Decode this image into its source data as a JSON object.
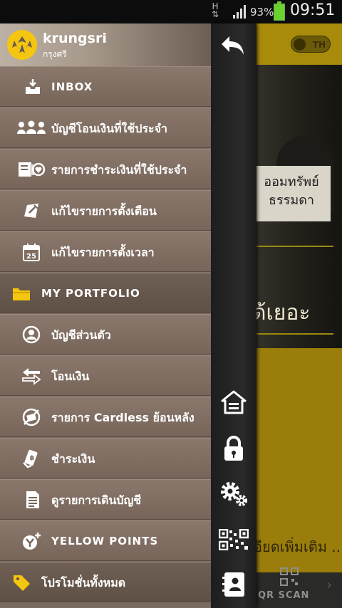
{
  "status_bar": {
    "network": "H",
    "battery_percent": "93%",
    "time": "09:51"
  },
  "header": {
    "brand_name": "krungsri",
    "brand_sub": "กรุงศรี"
  },
  "menu": {
    "items": [
      {
        "label": "INBOX",
        "icon": "inbox-icon"
      },
      {
        "label": "บัญชีโอนเงินที่ใช้ประจำ",
        "icon": "people-group-icon"
      },
      {
        "label": "รายการชำระเงินที่ใช้ประจำ",
        "icon": "bill-heart-icon"
      },
      {
        "label": "แก้ไขรายการตั้งเตือน",
        "icon": "edit-reminder-icon"
      },
      {
        "label": "แก้ไขรายการตั้งเวลา",
        "icon": "calendar-25-icon"
      },
      {
        "label": "MY PORTFOLIO",
        "icon": "folder-icon"
      },
      {
        "label": "บัญชีส่วนตัว",
        "icon": "person-account-icon"
      },
      {
        "label": "โอนเงิน",
        "icon": "transfer-arrows-icon"
      },
      {
        "label": "รายการ Cardless ย้อนหลัง",
        "icon": "cardless-icon"
      },
      {
        "label": "ชำระเงิน",
        "icon": "payment-icon"
      },
      {
        "label": "ดูรายการเดินบัญชี",
        "icon": "statement-icon"
      },
      {
        "label": "YELLOW POINTS",
        "icon": "yellow-points-icon"
      },
      {
        "label": "โปรโมชั่นทั้งหมด",
        "icon": "promotion-tag-icon"
      }
    ]
  },
  "action_bar": {
    "buttons": [
      "back-arrow-icon",
      "home-icon",
      "lock-icon",
      "settings-gears-icon",
      "qr-code-icon",
      "contact-icon"
    ]
  },
  "background_app": {
    "language_toggle": "TH",
    "sign_text": "ออมทรัพย์\nธรรมดา",
    "headline_fragment": "ด้เยอะ",
    "more_link": "อียดเพิ่มเติม ...",
    "bottom_tab_label": "QR SCAN"
  },
  "colors": {
    "brand_yellow": "#f5c60f",
    "drawer_bg": "#7b6a5f",
    "action_bar": "#222222"
  }
}
